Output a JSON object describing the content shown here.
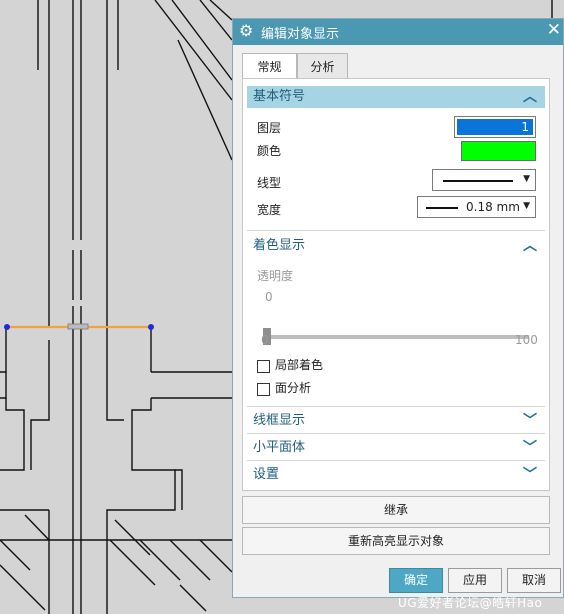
{
  "dialog": {
    "title": "编辑对象显示",
    "close_glyph": "✕",
    "gear_icon": "gear-icon"
  },
  "tabs": [
    {
      "label": "常规",
      "active": true
    },
    {
      "label": "分析",
      "active": false
    }
  ],
  "sections": {
    "basic_symbol": {
      "title": "基本符号",
      "expanded": true
    },
    "shading": {
      "title": "着色显示",
      "expanded": true
    },
    "wireframe": {
      "title": "线框显示",
      "expanded": false
    },
    "facet": {
      "title": "小平面体",
      "expanded": false
    },
    "settings": {
      "title": "设置",
      "expanded": false
    }
  },
  "basic": {
    "layer_label": "图层",
    "layer_value": "1",
    "color_label": "颜色",
    "color_value": "#00ff00",
    "linetype_label": "线型",
    "width_label": "宽度",
    "width_value": "0.18 mm"
  },
  "shading": {
    "transparency_label": "透明度",
    "transparency_current": "0",
    "slider_min": "0",
    "slider_max": "100",
    "slider_value": 0,
    "partial_shading_label": "局部着色",
    "face_analysis_label": "面分析"
  },
  "actions": {
    "inherit": "继承",
    "rehighlight": "重新高亮显示对象",
    "ok": "确定",
    "apply": "应用",
    "cancel": "取消"
  },
  "watermark": "UG爱好者论坛@皓轩Hao",
  "colors": {
    "titlebar": "#4a98b1",
    "section_highlight": "#a6d4e4",
    "selected_line": "#f7a040",
    "primary_button": "#4ea7c4"
  }
}
